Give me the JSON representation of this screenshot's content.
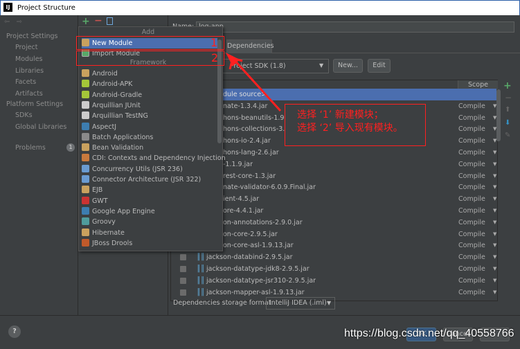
{
  "window": {
    "title": "Project Structure"
  },
  "sidebar": {
    "section1": "Project Settings",
    "items1": [
      "Project",
      "Modules",
      "Libraries",
      "Facets",
      "Artifacts"
    ],
    "section2": "Platform Settings",
    "items2": [
      "SDKs",
      "Global Libraries"
    ],
    "problems": "Problems",
    "problems_count": "1"
  },
  "popup": {
    "header_add": "Add",
    "new_module": "New Module",
    "import_module": "Import Module",
    "header_framework": "Framework",
    "frameworks": [
      "Android",
      "Android-APK",
      "Android-Gradle",
      "Arquillian JUnit",
      "Arquillian TestNG",
      "AspectJ",
      "Batch Applications",
      "Bean Validation",
      "CDI: Contexts and Dependency Injection",
      "Concurrency Utils (JSR 236)",
      "Connector Architecture (JSR 322)",
      "EJB",
      "GWT",
      "Google App Engine",
      "Groovy",
      "Hibernate",
      "JBoss Drools"
    ]
  },
  "module": {
    "name_label": "Name:",
    "name_value": "log-app",
    "tab": "Dependencies",
    "sdk": "Project SDK (1.8)",
    "new_btn": "New...",
    "edit_btn": "Edit",
    "scope_header": "Scope",
    "rows": [
      {
        "name": "dule source>",
        "scope": ""
      },
      {
        "name": "nate-1.3.4.jar",
        "scope": "Compile"
      },
      {
        "name": "hons-beanutils-1.9.3.jar",
        "scope": "Compile"
      },
      {
        "name": "hons-collections-3.2.2.jar",
        "scope": "Compile"
      },
      {
        "name": "hons-io-2.4.jar",
        "scope": "Compile"
      },
      {
        "name": "hons-lang-2.6.jar",
        "scope": "Compile"
      },
      {
        "name": "-1.1.9.jar",
        "scope": "Compile"
      },
      {
        "name": "rest-core-1.3.jar",
        "scope": "Compile"
      },
      {
        "name": "nate-validator-6.0.9.Final.jar",
        "scope": "Compile"
      },
      {
        "name": "ient-4.5.jar",
        "scope": "Compile"
      },
      {
        "name": "ore-4.4.1.jar",
        "scope": "Compile"
      },
      {
        "name": "on-annotations-2.9.0.jar",
        "scope": "Compile"
      },
      {
        "name": "on-core-2.9.5.jar",
        "scope": "Compile"
      },
      {
        "name": "on-core-asl-1.9.13.jar",
        "scope": "Compile"
      },
      {
        "name": "jackson-databind-2.9.5.jar",
        "scope": "Compile"
      },
      {
        "name": "jackson-datatype-jdk8-2.9.5.jar",
        "scope": "Compile"
      },
      {
        "name": "jackson-datatype-jsr310-2.9.5.jar",
        "scope": "Compile"
      },
      {
        "name": "jackson-mapper-asl-1.9.13.jar",
        "scope": "Compile"
      }
    ],
    "storage_label": "Dependencies storage format:",
    "storage_value": "IntelliJ IDEA (.iml)"
  },
  "footer": {
    "ok": "OK",
    "cancel": "Cancel",
    "help": "?"
  },
  "annotation": {
    "mark1": "1",
    "mark2": "2",
    "line1": "选择 ‘1’ 新建模块；",
    "line2": "选择 ‘2’ 导入现有模块。"
  },
  "watermark": "https://blog.csdn.net/qq_40558766",
  "colors": {
    "selection": "#4b6eaf",
    "annotation": "#ff2020",
    "background": "#3c3f41"
  }
}
